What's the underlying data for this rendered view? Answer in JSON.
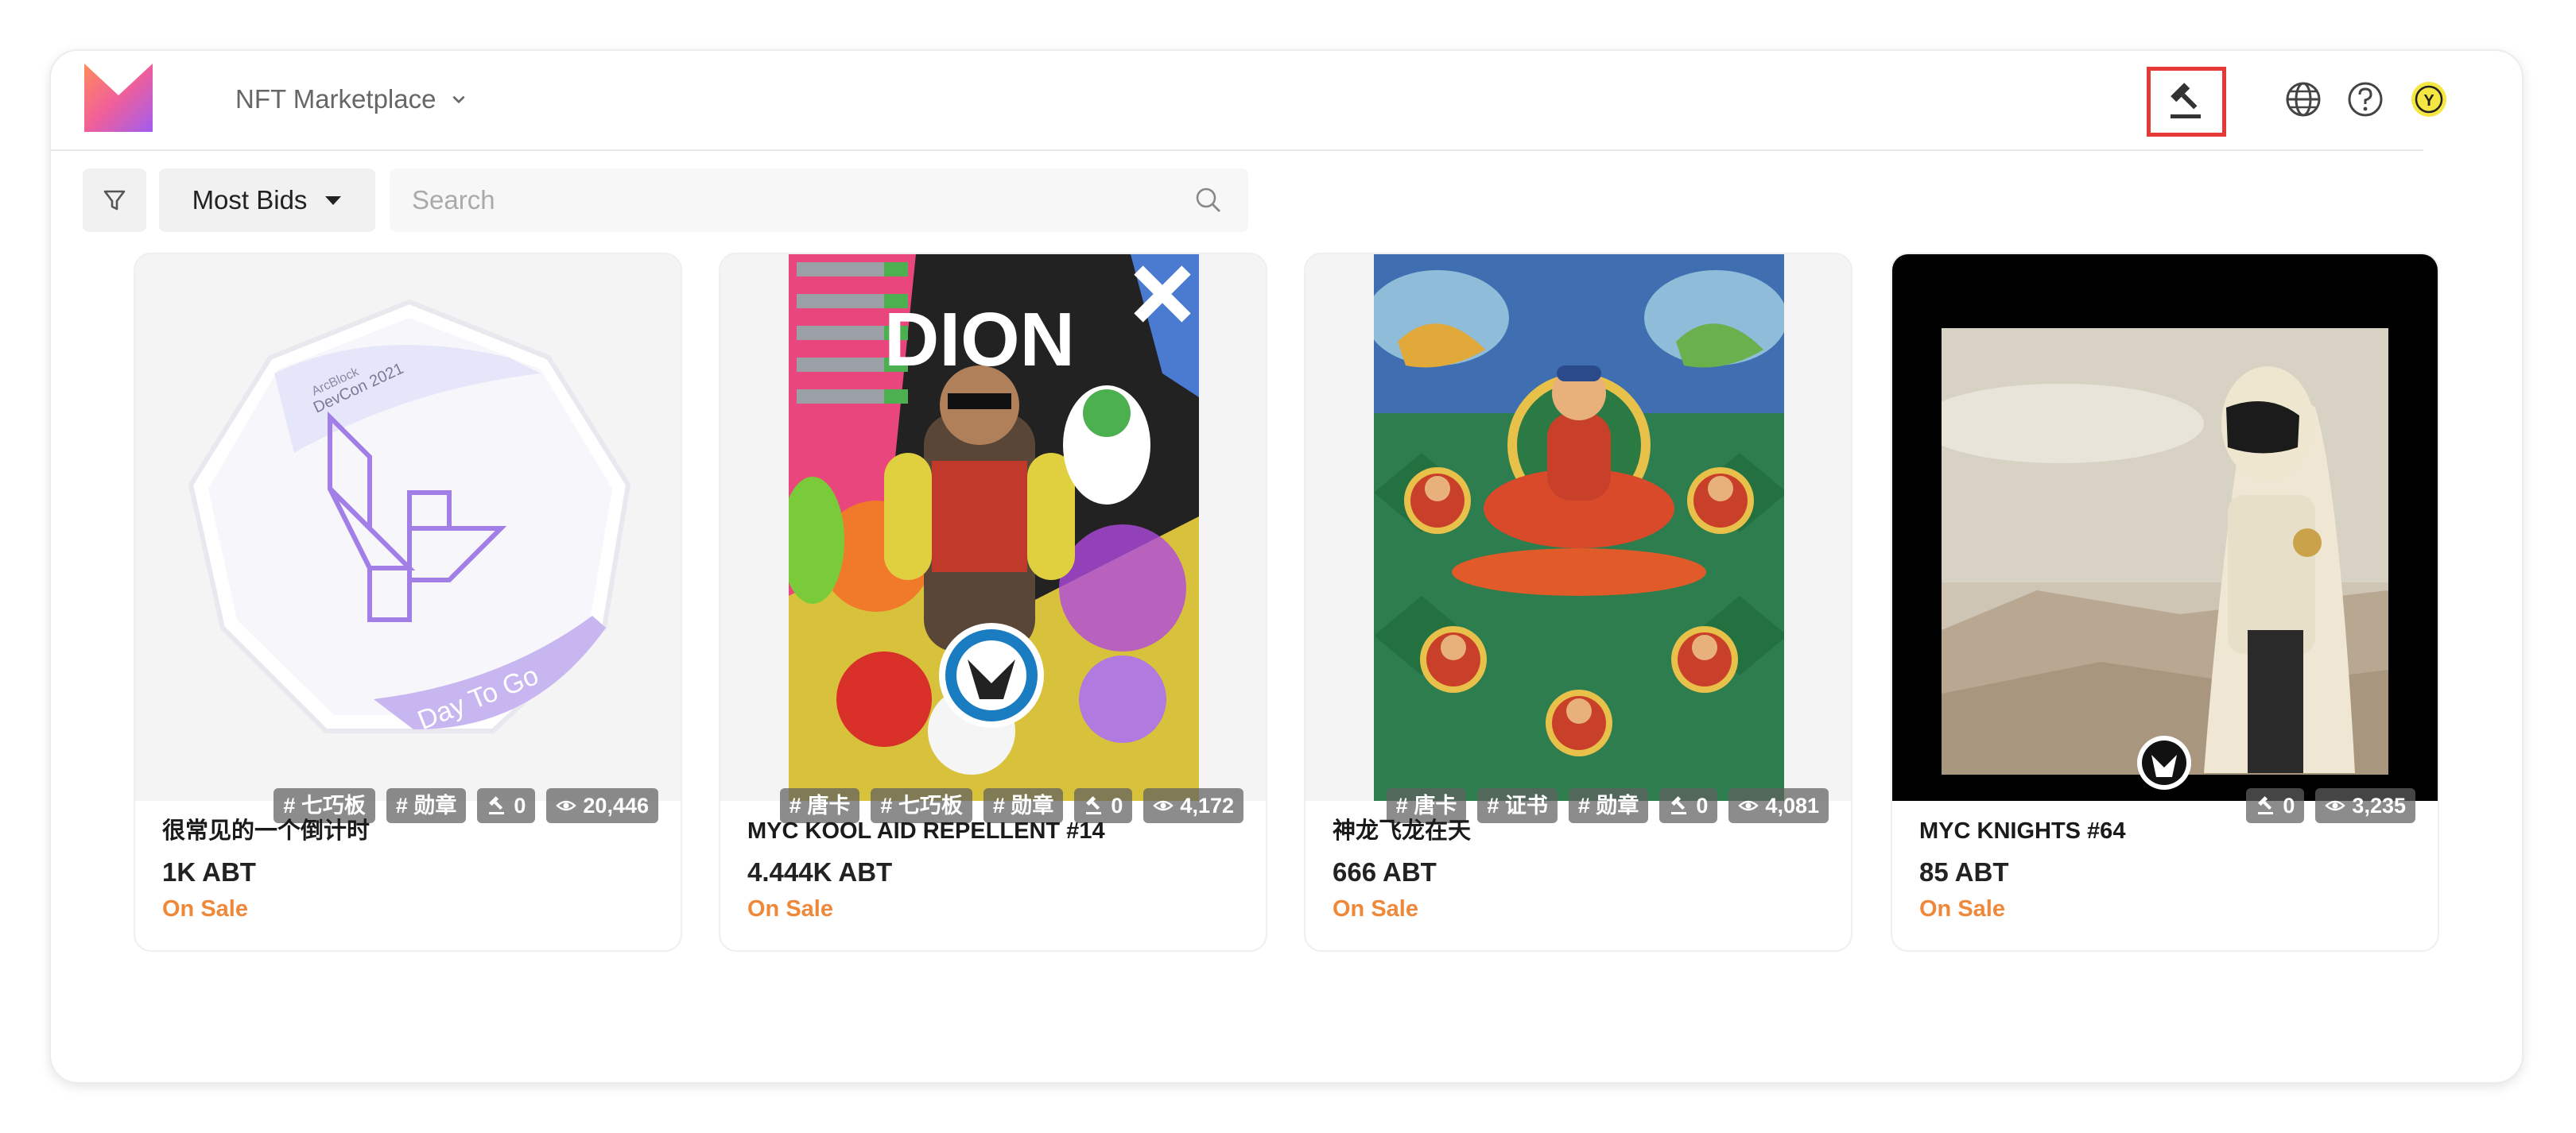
{
  "header": {
    "app_name": "NFT Marketplace",
    "icons": [
      "gavel-icon",
      "globe-icon",
      "help-icon",
      "avatar"
    ],
    "avatar_letter": "Y"
  },
  "toolbar": {
    "sort_label": "Most Bids",
    "search_placeholder": "Search",
    "search_value": ""
  },
  "cards": [
    {
      "name": "很常见的一个倒计时",
      "price": "1K ABT",
      "status": "On Sale",
      "tags": [
        "# 七巧板",
        "# 勋章"
      ],
      "bids": "0",
      "views": "20,446",
      "art_badge": "ArcBlock",
      "art_event": "DevCon 2021",
      "art_caption": "Day To Go"
    },
    {
      "name": "MYC KOOL AID REPELLENT #14",
      "price": "4.444K ABT",
      "status": "On Sale",
      "tags": [
        "# 唐卡",
        "# 七巧板",
        "# 勋章"
      ],
      "bids": "0",
      "views": "4,172",
      "art_title": "DION"
    },
    {
      "name": "神龙飞龙在天",
      "price": "666 ABT",
      "status": "On Sale",
      "tags": [
        "# 唐卡",
        "# 证书",
        "# 勋章"
      ],
      "bids": "0",
      "views": "4,081"
    },
    {
      "name": "MYC KNIGHTS #64",
      "price": "85 ABT",
      "status": "On Sale",
      "tags": [],
      "bids": "0",
      "views": "3,235"
    }
  ],
  "colors": {
    "status_on_sale": "#f0883a",
    "highlight_box": "#e53935",
    "avatar_bg": "#f5e642"
  }
}
